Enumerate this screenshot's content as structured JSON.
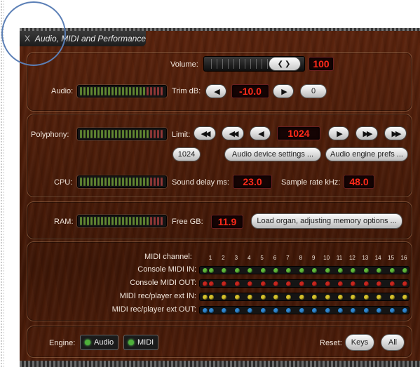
{
  "window": {
    "title": "Audio, MIDI and Performance",
    "close_glyph": "X"
  },
  "audio": {
    "volume_label": "Volume:",
    "volume_value": "100",
    "volume_level": 0.65,
    "audio_label": "Audio:",
    "trim_label": "Trim dB:",
    "trim_value": "-10.0",
    "reset_value": "0"
  },
  "performance": {
    "polyphony_label": "Polyphony:",
    "limit_label": "Limit:",
    "limit_value": "1024",
    "preset_1024": "1024",
    "audio_device_settings": "Audio device settings ...",
    "audio_engine_prefs": "Audio engine prefs ...",
    "cpu_label": "CPU:",
    "sound_delay_label": "Sound delay ms:",
    "sound_delay_value": "23.0",
    "sample_rate_label": "Sample rate kHz:",
    "sample_rate_value": "48.0"
  },
  "memory": {
    "ram_label": "RAM:",
    "free_gb_label": "Free GB:",
    "free_gb_value": "11.9",
    "load_organ_button": "Load organ, adjusting memory options ..."
  },
  "midi": {
    "channel_label": "MIDI channel:",
    "channels": [
      "1",
      "2",
      "3",
      "4",
      "5",
      "6",
      "7",
      "8",
      "9",
      "10",
      "11",
      "12",
      "13",
      "14",
      "15",
      "16"
    ],
    "rows": [
      {
        "label": "Console MIDI IN:",
        "color": "#5fb83a"
      },
      {
        "label": "Console MIDI OUT:",
        "color": "#c8261e"
      },
      {
        "label": "MIDI rec/player ext IN:",
        "color": "#d6c12c"
      },
      {
        "label": "MIDI rec/player ext OUT:",
        "color": "#2f86cf"
      }
    ]
  },
  "footer": {
    "engine_label": "Engine:",
    "engine_audio": "Audio",
    "engine_midi": "MIDI",
    "reset_label": "Reset:",
    "reset_keys": "Keys",
    "reset_all": "All"
  },
  "icons": {
    "prev": "arrow-left-icon",
    "next": "arrow-right-icon",
    "fast_back": "double-arrow-left-icon",
    "fast_fwd": "double-arrow-right-icon"
  }
}
